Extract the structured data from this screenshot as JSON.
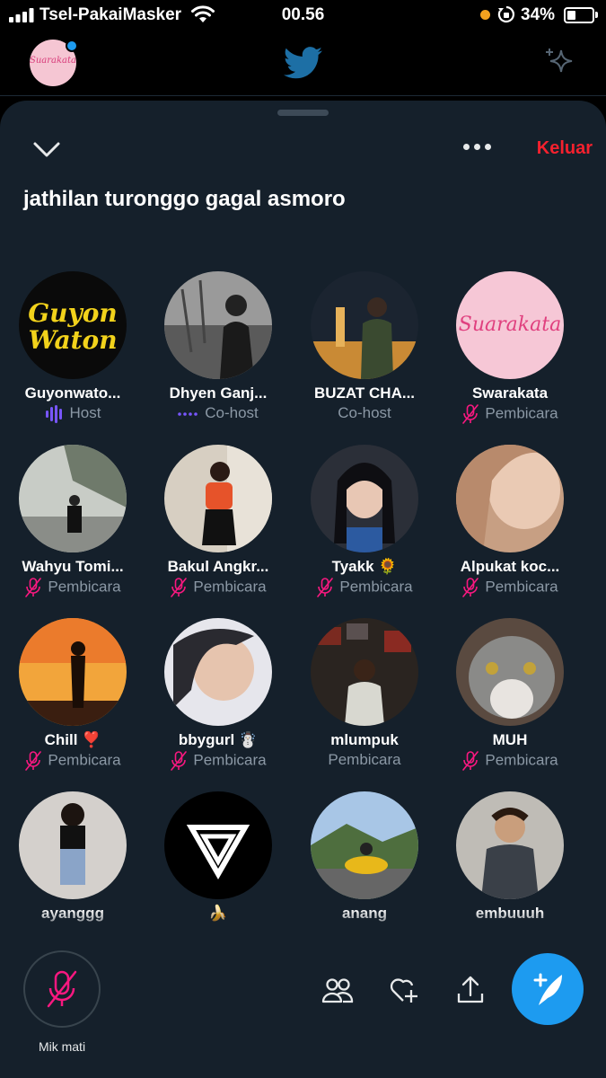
{
  "status_bar": {
    "carrier": "Tsel-PakaiMasker",
    "time": "00.56",
    "battery_percent": "34%",
    "battery_level": 0.34
  },
  "header": {
    "avatar_text": "Suarakata"
  },
  "space": {
    "title": "jathilan turonggo gagal asmoro",
    "leave_label": "Keluar"
  },
  "participants": [
    {
      "name": "Guyonwato...",
      "role": "Host",
      "role_icon": "sound-wave-icon",
      "role_color": "#7856ff",
      "avatar": "guyon-waton-logo"
    },
    {
      "name": "Dhyen Ganj...",
      "role": "Co-host",
      "role_icon": "dotted-line-icon",
      "role_color": "#7856ff",
      "avatar": "photo-bw-man-singing"
    },
    {
      "name": "BUZAT CHA...",
      "role": "Co-host",
      "role_icon": "",
      "role_color": "",
      "avatar": "photo-man-monument-night"
    },
    {
      "name": "Swarakata",
      "role": "Pembicara",
      "role_icon": "mic-off-icon",
      "role_color": "#f91880",
      "avatar": "suarakata-logo"
    },
    {
      "name": "Wahyu Tomi...",
      "role": "Pembicara",
      "role_icon": "mic-off-icon",
      "role_color": "#f91880",
      "avatar": "photo-man-street"
    },
    {
      "name": "Bakul Angkr...",
      "role": "Pembicara",
      "role_icon": "mic-off-icon",
      "role_color": "#f91880",
      "avatar": "photo-woman-orange-top"
    },
    {
      "name": "Tyakk 🌻",
      "role": "Pembicara",
      "role_icon": "mic-off-icon",
      "role_color": "#f91880",
      "avatar": "photo-woman-selfie"
    },
    {
      "name": "Alpukat koc...",
      "role": "Pembicara",
      "role_icon": "mic-off-icon",
      "role_color": "#f91880",
      "avatar": "photo-hijab-closeup"
    },
    {
      "name": "Chill ❣️",
      "role": "Pembicara",
      "role_icon": "mic-off-icon",
      "role_color": "#f91880",
      "avatar": "photo-sunset-silhouette"
    },
    {
      "name": "bbygurl ☃️",
      "role": "Pembicara",
      "role_icon": "mic-off-icon",
      "role_color": "#f91880",
      "avatar": "photo-hijab-smiling"
    },
    {
      "name": "mlumpuk",
      "role": "Pembicara",
      "role_icon": "",
      "role_color": "",
      "avatar": "photo-man-posters"
    },
    {
      "name": "MUH",
      "role": "Pembicara",
      "role_icon": "mic-off-icon",
      "role_color": "#f91880",
      "avatar": "photo-cat"
    },
    {
      "name": "ayanggg",
      "role": "",
      "role_icon": "",
      "role_color": "",
      "avatar": "photo-woman-mirror"
    },
    {
      "name": "🍌",
      "role": "",
      "role_icon": "",
      "role_color": "",
      "avatar": "triangle-logo"
    },
    {
      "name": "anang",
      "role": "",
      "role_icon": "",
      "role_color": "",
      "avatar": "photo-motorbike-mountain"
    },
    {
      "name": "embuuuh",
      "role": "",
      "role_icon": "",
      "role_color": "",
      "avatar": "photo-man-glasses"
    }
  ],
  "bottom_bar": {
    "mic_label": "Mik mati",
    "actions": [
      "people-icon",
      "heart-plus-icon",
      "share-icon",
      "compose-icon"
    ]
  },
  "colors": {
    "sheet_bg": "#15202b",
    "accent": "#1d9bf0",
    "leave": "#f4212e",
    "muted_mic": "#f91880",
    "host": "#7856ff"
  }
}
